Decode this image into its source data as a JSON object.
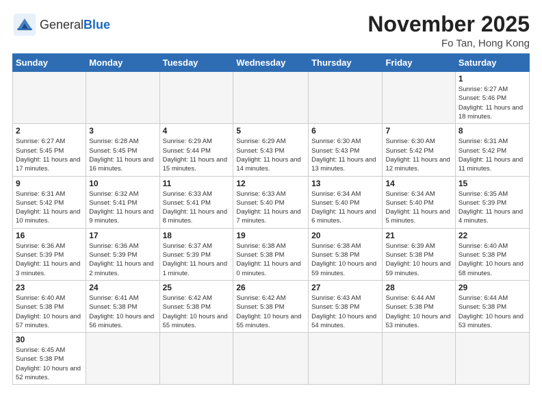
{
  "header": {
    "logo_general": "General",
    "logo_blue": "Blue",
    "month_title": "November 2025",
    "location": "Fo Tan, Hong Kong"
  },
  "weekdays": [
    "Sunday",
    "Monday",
    "Tuesday",
    "Wednesday",
    "Thursday",
    "Friday",
    "Saturday"
  ],
  "weeks": [
    [
      {
        "day": "",
        "info": ""
      },
      {
        "day": "",
        "info": ""
      },
      {
        "day": "",
        "info": ""
      },
      {
        "day": "",
        "info": ""
      },
      {
        "day": "",
        "info": ""
      },
      {
        "day": "",
        "info": ""
      },
      {
        "day": "1",
        "info": "Sunrise: 6:27 AM\nSunset: 5:46 PM\nDaylight: 11 hours\nand 18 minutes."
      }
    ],
    [
      {
        "day": "2",
        "info": "Sunrise: 6:27 AM\nSunset: 5:45 PM\nDaylight: 11 hours\nand 17 minutes."
      },
      {
        "day": "3",
        "info": "Sunrise: 6:28 AM\nSunset: 5:45 PM\nDaylight: 11 hours\nand 16 minutes."
      },
      {
        "day": "4",
        "info": "Sunrise: 6:29 AM\nSunset: 5:44 PM\nDaylight: 11 hours\nand 15 minutes."
      },
      {
        "day": "5",
        "info": "Sunrise: 6:29 AM\nSunset: 5:43 PM\nDaylight: 11 hours\nand 14 minutes."
      },
      {
        "day": "6",
        "info": "Sunrise: 6:30 AM\nSunset: 5:43 PM\nDaylight: 11 hours\nand 13 minutes."
      },
      {
        "day": "7",
        "info": "Sunrise: 6:30 AM\nSunset: 5:42 PM\nDaylight: 11 hours\nand 12 minutes."
      },
      {
        "day": "8",
        "info": "Sunrise: 6:31 AM\nSunset: 5:42 PM\nDaylight: 11 hours\nand 11 minutes."
      }
    ],
    [
      {
        "day": "9",
        "info": "Sunrise: 6:31 AM\nSunset: 5:42 PM\nDaylight: 11 hours\nand 10 minutes."
      },
      {
        "day": "10",
        "info": "Sunrise: 6:32 AM\nSunset: 5:41 PM\nDaylight: 11 hours\nand 9 minutes."
      },
      {
        "day": "11",
        "info": "Sunrise: 6:33 AM\nSunset: 5:41 PM\nDaylight: 11 hours\nand 8 minutes."
      },
      {
        "day": "12",
        "info": "Sunrise: 6:33 AM\nSunset: 5:40 PM\nDaylight: 11 hours\nand 7 minutes."
      },
      {
        "day": "13",
        "info": "Sunrise: 6:34 AM\nSunset: 5:40 PM\nDaylight: 11 hours\nand 6 minutes."
      },
      {
        "day": "14",
        "info": "Sunrise: 6:34 AM\nSunset: 5:40 PM\nDaylight: 11 hours\nand 5 minutes."
      },
      {
        "day": "15",
        "info": "Sunrise: 6:35 AM\nSunset: 5:39 PM\nDaylight: 11 hours\nand 4 minutes."
      }
    ],
    [
      {
        "day": "16",
        "info": "Sunrise: 6:36 AM\nSunset: 5:39 PM\nDaylight: 11 hours\nand 3 minutes."
      },
      {
        "day": "17",
        "info": "Sunrise: 6:36 AM\nSunset: 5:39 PM\nDaylight: 11 hours\nand 2 minutes."
      },
      {
        "day": "18",
        "info": "Sunrise: 6:37 AM\nSunset: 5:39 PM\nDaylight: 11 hours\nand 1 minute."
      },
      {
        "day": "19",
        "info": "Sunrise: 6:38 AM\nSunset: 5:38 PM\nDaylight: 11 hours\nand 0 minutes."
      },
      {
        "day": "20",
        "info": "Sunrise: 6:38 AM\nSunset: 5:38 PM\nDaylight: 10 hours\nand 59 minutes."
      },
      {
        "day": "21",
        "info": "Sunrise: 6:39 AM\nSunset: 5:38 PM\nDaylight: 10 hours\nand 59 minutes."
      },
      {
        "day": "22",
        "info": "Sunrise: 6:40 AM\nSunset: 5:38 PM\nDaylight: 10 hours\nand 58 minutes."
      }
    ],
    [
      {
        "day": "23",
        "info": "Sunrise: 6:40 AM\nSunset: 5:38 PM\nDaylight: 10 hours\nand 57 minutes."
      },
      {
        "day": "24",
        "info": "Sunrise: 6:41 AM\nSunset: 5:38 PM\nDaylight: 10 hours\nand 56 minutes."
      },
      {
        "day": "25",
        "info": "Sunrise: 6:42 AM\nSunset: 5:38 PM\nDaylight: 10 hours\nand 55 minutes."
      },
      {
        "day": "26",
        "info": "Sunrise: 6:42 AM\nSunset: 5:38 PM\nDaylight: 10 hours\nand 55 minutes."
      },
      {
        "day": "27",
        "info": "Sunrise: 6:43 AM\nSunset: 5:38 PM\nDaylight: 10 hours\nand 54 minutes."
      },
      {
        "day": "28",
        "info": "Sunrise: 6:44 AM\nSunset: 5:38 PM\nDaylight: 10 hours\nand 53 minutes."
      },
      {
        "day": "29",
        "info": "Sunrise: 6:44 AM\nSunset: 5:38 PM\nDaylight: 10 hours\nand 53 minutes."
      }
    ],
    [
      {
        "day": "30",
        "info": "Sunrise: 6:45 AM\nSunset: 5:38 PM\nDaylight: 10 hours\nand 52 minutes."
      },
      {
        "day": "",
        "info": ""
      },
      {
        "day": "",
        "info": ""
      },
      {
        "day": "",
        "info": ""
      },
      {
        "day": "",
        "info": ""
      },
      {
        "day": "",
        "info": ""
      },
      {
        "day": "",
        "info": ""
      }
    ]
  ]
}
